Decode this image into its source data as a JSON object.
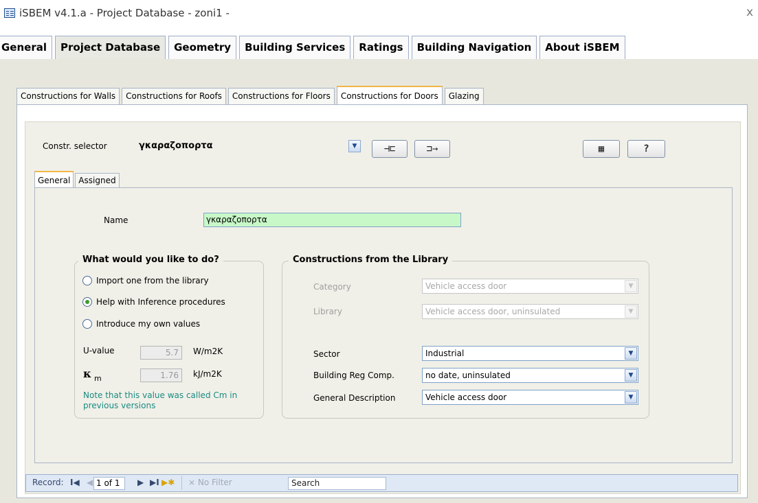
{
  "window": {
    "title": "iSBEM v4.1.a - Project Database - zoni1 -",
    "close_glyph": "x",
    "icon": "access-form-icon"
  },
  "main_tabs": [
    {
      "label": "General"
    },
    {
      "label": "Project Database",
      "active": true
    },
    {
      "label": "Geometry"
    },
    {
      "label": "Building Services"
    },
    {
      "label": "Ratings"
    },
    {
      "label": "Building Navigation"
    },
    {
      "label": "About iSBEM"
    }
  ],
  "sub_tabs": [
    {
      "label": "Constructions for Walls"
    },
    {
      "label": "Constructions for Roofs"
    },
    {
      "label": "Constructions for Floors"
    },
    {
      "label": "Constructions for Doors",
      "active": true
    },
    {
      "label": "Glazing"
    }
  ],
  "selector": {
    "label": "Constr. selector",
    "value": "γκαραζοπορτα"
  },
  "toolbar": {
    "btn_a_glyph": "⊣⊏",
    "btn_b_glyph": "⊐→",
    "btn_c_glyph": "▦",
    "btn_d_glyph": "?"
  },
  "inner_tabs": [
    {
      "label": "General",
      "active": true
    },
    {
      "label": "Assigned"
    }
  ],
  "name_field": {
    "label": "Name",
    "value": "γκαραζοπορτα"
  },
  "what_to_do": {
    "title": "What would you like to do?",
    "options": [
      {
        "label": "Import one from the library",
        "selected": false
      },
      {
        "label": "Help with Inference procedures",
        "selected": true
      },
      {
        "label": "Introduce my own values",
        "selected": false
      }
    ],
    "u_value": {
      "label": "U-value",
      "value": "5.7",
      "unit": "W/m2K"
    },
    "km": {
      "symbol": "κ",
      "subscript": "m",
      "value": "1.76",
      "unit": "kJ/m2K"
    },
    "note": "Note that this value was called Cm in previous versions"
  },
  "library": {
    "title": "Constructions from the Library",
    "category": {
      "label": "Category",
      "value": "Vehicle access door"
    },
    "library": {
      "label": "Library",
      "value": "Vehicle access door, uninsulated"
    },
    "sector": {
      "label": "Sector",
      "value": "Industrial"
    },
    "building_reg": {
      "label": "Building Reg Comp.",
      "value": "no date, uninsulated"
    },
    "general_description": {
      "label": "General Description",
      "value": "Vehicle access door"
    }
  },
  "navigator": {
    "record_label": "Record:",
    "position": "1 of 1",
    "filter_label": "No Filter",
    "search_label": "Search",
    "first_glyph": "I◀",
    "prev_glyph": "◀",
    "next_glyph": "▶",
    "last_glyph": "▶I",
    "new_glyph": "▶✱"
  },
  "colors": {
    "form_background": "#e7e7dd",
    "name_field_background": "#c8f8c8",
    "note_text": "#1a8a82",
    "active_tab_accent": "#f2b646"
  }
}
